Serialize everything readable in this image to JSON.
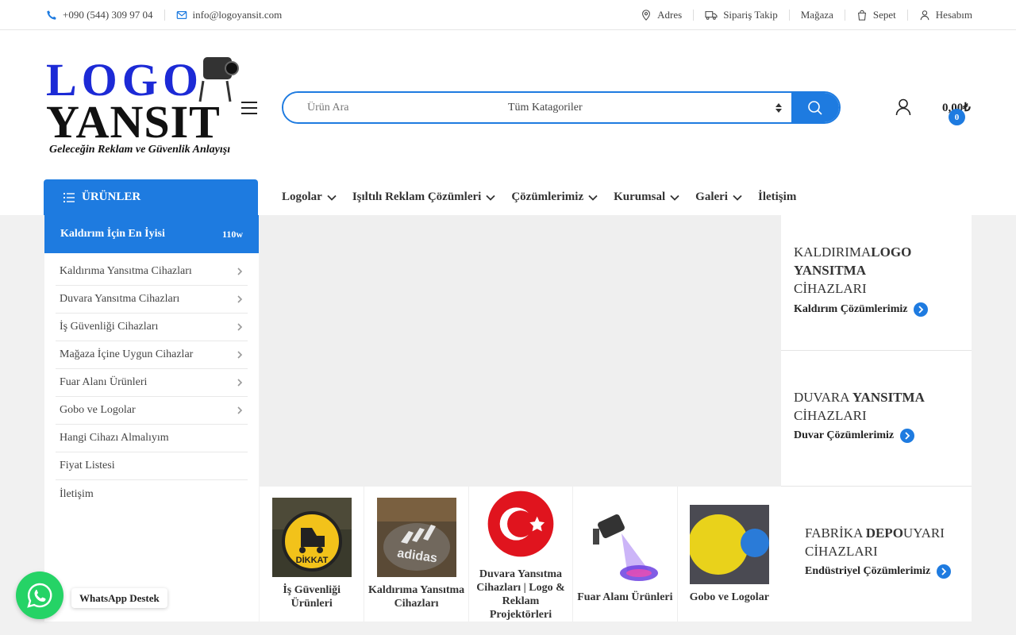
{
  "topbar": {
    "phone": "+090 (544) 309 97 04",
    "email": "info@logoyansit.com",
    "links": [
      {
        "label": "Adres",
        "icon": "map-pin-icon"
      },
      {
        "label": "Sipariş Takip",
        "icon": "truck-icon"
      },
      {
        "label": "Mağaza",
        "icon": ""
      },
      {
        "label": "Sepet",
        "icon": "shopping-bag-icon"
      },
      {
        "label": "Hesabım",
        "icon": "user-icon"
      }
    ]
  },
  "logo": {
    "line1": "LOGO",
    "line2": "YANSIT",
    "tagline": "Geleceğin Reklam ve Güvenlik Anlayışı"
  },
  "search": {
    "placeholder": "Ürün Ara",
    "category": "Tüm Katagoriler"
  },
  "cart": {
    "total": "0,00₺",
    "count": "0"
  },
  "nav": {
    "products_label": "ÜRÜNLER",
    "items": [
      "Logolar",
      "Işıltılı Reklam Çözümleri",
      "Çözümlerimiz",
      "Kurumsal",
      "Galeri",
      "İletişim"
    ]
  },
  "sidebar": {
    "header": "Kaldırım İçin En İyisi",
    "badge": "110w",
    "items": [
      "Kaldırıma Yansıtma Cihazları",
      "Duvara Yansıtma Cihazları",
      "İş Güvenliği Cihazları",
      "Mağaza İçine Uygun Cihazlar",
      "Fuar Alanı Ürünleri",
      "Gobo ve Logolar",
      "Hangi Cihazı Almalıyım",
      "Fiyat Listesi",
      "İletişim"
    ]
  },
  "products": [
    {
      "label": "İş Güvenliği Ürünleri",
      "thumb": "DİKKAT"
    },
    {
      "label": "Kaldırıma Yansıtma Cihazları",
      "thumb": ""
    },
    {
      "label": "Duvara Yansıtma Cihazları | Logo & Reklam Projektörleri",
      "thumb": ""
    },
    {
      "label": "Fuar Alanı Ürünleri",
      "thumb": ""
    },
    {
      "label": "Gobo ve Logolar",
      "thumb": ""
    }
  ],
  "banners": [
    {
      "t1": "KALDIRIMA",
      "t2": "LOGO YANSITMA",
      "t3": "CİHAZLARI",
      "link": "Kaldırım Çözümlerimiz"
    },
    {
      "t1": "DUVARA ",
      "t2": "YANSITMA",
      "t3": "CİHAZLARI",
      "link": "Duvar Çözümlerimiz"
    },
    {
      "t1": "FABRİKA ",
      "t2": "DEPO",
      "t3": "UYARI CİHAZLARI",
      "link": "Endüstriyel Çözümlerimiz"
    }
  ],
  "whatsapp": {
    "label": "WhatsApp Destek"
  },
  "colors": {
    "accent": "#1e7be0",
    "whatsapp": "#25d366"
  }
}
